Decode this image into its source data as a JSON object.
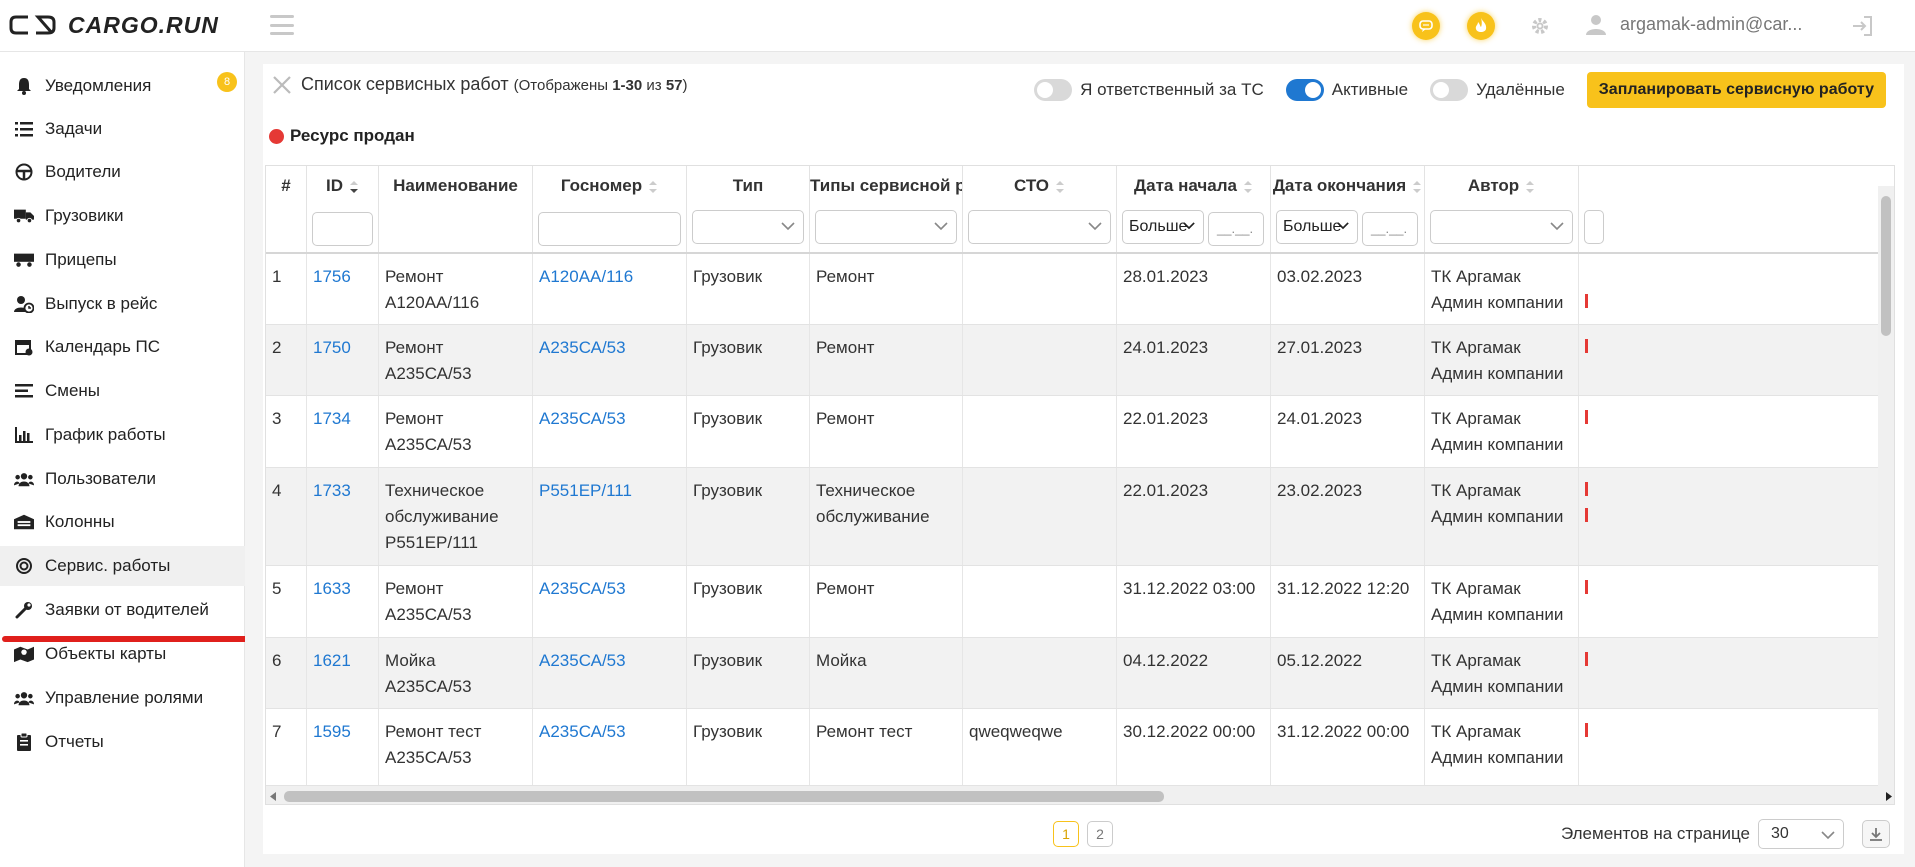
{
  "brand": {
    "name": "CARGO.RUN"
  },
  "header": {
    "user": "argamak-admin@car..."
  },
  "sidebar": {
    "items": [
      {
        "label": "Уведомления",
        "icon": "bell-icon",
        "badge": "8"
      },
      {
        "label": "Задачи",
        "icon": "tasks-list-icon"
      },
      {
        "label": "Водители",
        "icon": "steering-wheel-icon"
      },
      {
        "label": "Грузовики",
        "icon": "truck-icon"
      },
      {
        "label": "Прицепы",
        "icon": "trailer-icon"
      },
      {
        "label": "Выпуск в рейс",
        "icon": "user-clock-icon"
      },
      {
        "label": "Календарь ПС",
        "icon": "calendar-icon"
      },
      {
        "label": "Смены",
        "icon": "shifts-icon"
      },
      {
        "label": "График работы",
        "icon": "bar-chart-icon"
      },
      {
        "label": "Пользователи",
        "icon": "users-icon"
      },
      {
        "label": "Колонны",
        "icon": "warehouse-icon"
      },
      {
        "label": "Сервис. работы",
        "icon": "service-gear-icon",
        "active": true
      },
      {
        "label": "Заявки от водителей",
        "icon": "wrench-icon"
      },
      {
        "label": "Объекты карты",
        "icon": "map-marker-icon"
      },
      {
        "label": "Управление ролями",
        "icon": "roles-icon"
      },
      {
        "label": "Отчеты",
        "icon": "report-icon"
      }
    ]
  },
  "page": {
    "title": "Список сервисных работ",
    "shown_prefix": "(Отображены ",
    "shown_range": "1-30",
    "shown_of": " из ",
    "shown_total": "57",
    "shown_suffix": ")",
    "toggles": [
      {
        "label": "Я ответственный за ТС",
        "on": false
      },
      {
        "label": "Активные",
        "on": true
      },
      {
        "label": "Удалённые",
        "on": false
      }
    ],
    "plan_button": "Запланировать сервисную работу",
    "status_label": "Ресурс продан"
  },
  "table": {
    "columns": [
      {
        "label": "#"
      },
      {
        "label": "ID"
      },
      {
        "label": "Наименование"
      },
      {
        "label": "Госномер"
      },
      {
        "label": "Тип"
      },
      {
        "label": "Типы сервисной ра..."
      },
      {
        "label": "СТО"
      },
      {
        "label": "Дата начала"
      },
      {
        "label": "Дата окончания"
      },
      {
        "label": "Автор"
      }
    ],
    "filters": {
      "date_start_op": "Больше",
      "date_start_placeholder": "__.__.",
      "date_end_op": "Больше",
      "date_end_placeholder": "__.__."
    },
    "rows": [
      {
        "n": "1",
        "id": "1756",
        "name": "Ремонт А120АА/116",
        "plate": "А120АА/116",
        "type": "Грузовик",
        "stype": "Ремонт",
        "sto": "",
        "start": "28.01.2023",
        "end": "03.02.2023",
        "author": "ТК Аргамак Админ компании"
      },
      {
        "n": "2",
        "id": "1750",
        "name": "Ремонт А235СА/53",
        "plate": "А235СА/53",
        "type": "Грузовик",
        "stype": "Ремонт",
        "sto": "",
        "start": "24.01.2023",
        "end": "27.01.2023",
        "author": "ТК Аргамак Админ компании"
      },
      {
        "n": "3",
        "id": "1734",
        "name": "Ремонт А235СА/53",
        "plate": "А235СА/53",
        "type": "Грузовик",
        "stype": "Ремонт",
        "sto": "",
        "start": "22.01.2023",
        "end": "24.01.2023",
        "author": "ТК Аргамак Админ компании"
      },
      {
        "n": "4",
        "id": "1733",
        "name": "Техническое обслуживание Р551ЕР/111",
        "plate": "Р551ЕР/111",
        "type": "Грузовик",
        "stype": "Техническое обслуживание",
        "sto": "",
        "start": "22.01.2023",
        "end": "23.02.2023",
        "author": "ТК Аргамак Админ компании"
      },
      {
        "n": "5",
        "id": "1633",
        "name": "Ремонт А235СА/53",
        "plate": "А235СА/53",
        "type": "Грузовик",
        "stype": "Ремонт",
        "sto": "",
        "start": "31.12.2022 03:00",
        "end": "31.12.2022 12:20",
        "author": "ТК Аргамак Админ компании"
      },
      {
        "n": "6",
        "id": "1621",
        "name": "Мойка А235СА/53",
        "plate": "А235СА/53",
        "type": "Грузовик",
        "stype": "Мойка",
        "sto": "",
        "start": "04.12.2022",
        "end": "05.12.2022",
        "author": "ТК Аргамак Админ компании"
      },
      {
        "n": "7",
        "id": "1595",
        "name": "Ремонт тест А235СА/53",
        "plate": "А235СА/53",
        "type": "Грузовик",
        "stype": "Ремонт тест",
        "sto": "qweqweqwe",
        "start": "30.12.2022 00:00",
        "end": "31.12.2022 00:00",
        "author": "ТК Аргамак Админ компании"
      }
    ]
  },
  "pagination": {
    "pages": [
      "1",
      "2"
    ],
    "current": "1"
  },
  "per_page": {
    "label": "Элементов на странице",
    "value": "30"
  },
  "colors": {
    "accent": "#f8c21b",
    "link": "#1f78d1",
    "danger": "#e53935"
  }
}
